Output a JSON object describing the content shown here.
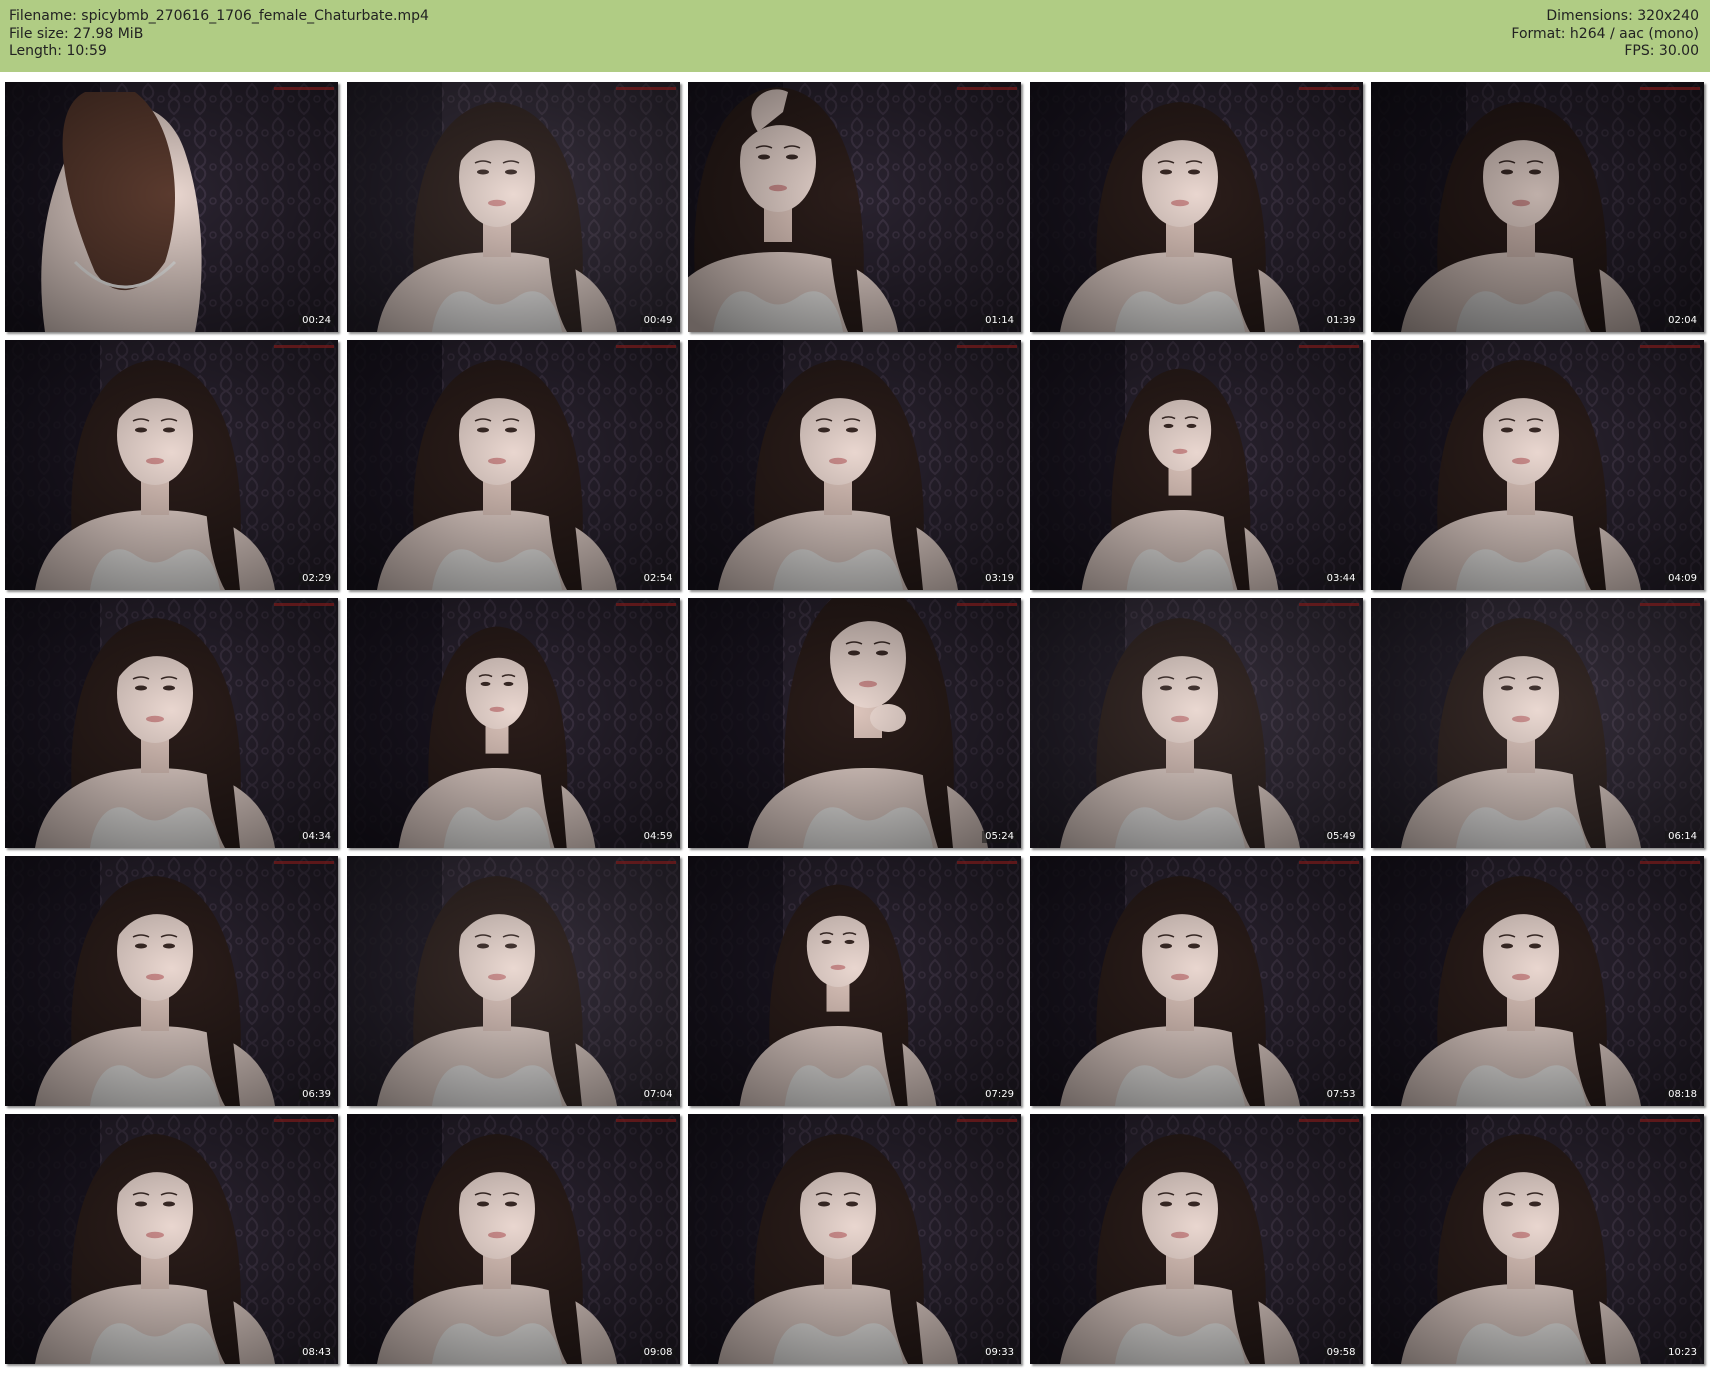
{
  "header": {
    "filename": "Filename: spicybmb_270616_1706_female_Chaturbate.mp4",
    "filesize": "File size: 27.98 MiB",
    "length": "Length: 10:59",
    "dimensions": "Dimensions: 320x240",
    "format": "Format: h264 / aac (mono)",
    "fps": "FPS: 30.00"
  },
  "colors": {
    "header_bg": "#b0cc84",
    "page_bg": "#ffffff",
    "timestamp_text": "#ffffff"
  },
  "thumbnails": [
    {
      "time": "00:24",
      "pose": "back"
    },
    {
      "time": "00:49",
      "pose": "front-bright"
    },
    {
      "time": "01:14",
      "pose": "arm-up"
    },
    {
      "time": "01:39",
      "pose": "front"
    },
    {
      "time": "02:04",
      "pose": "front-dark"
    },
    {
      "time": "02:29",
      "pose": "front"
    },
    {
      "time": "02:54",
      "pose": "front"
    },
    {
      "time": "03:19",
      "pose": "front"
    },
    {
      "time": "03:44",
      "pose": "front-far"
    },
    {
      "time": "04:09",
      "pose": "front"
    },
    {
      "time": "04:34",
      "pose": "front"
    },
    {
      "time": "04:59",
      "pose": "front-far"
    },
    {
      "time": "05:24",
      "pose": "hand-neck"
    },
    {
      "time": "05:49",
      "pose": "front-bright"
    },
    {
      "time": "06:14",
      "pose": "front-bright"
    },
    {
      "time": "06:39",
      "pose": "front"
    },
    {
      "time": "07:04",
      "pose": "front-bright"
    },
    {
      "time": "07:29",
      "pose": "front-far"
    },
    {
      "time": "07:53",
      "pose": "front"
    },
    {
      "time": "08:18",
      "pose": "front"
    },
    {
      "time": "08:43",
      "pose": "front"
    },
    {
      "time": "09:08",
      "pose": "front"
    },
    {
      "time": "09:33",
      "pose": "front"
    },
    {
      "time": "09:58",
      "pose": "front"
    },
    {
      "time": "10:23",
      "pose": "front"
    }
  ]
}
